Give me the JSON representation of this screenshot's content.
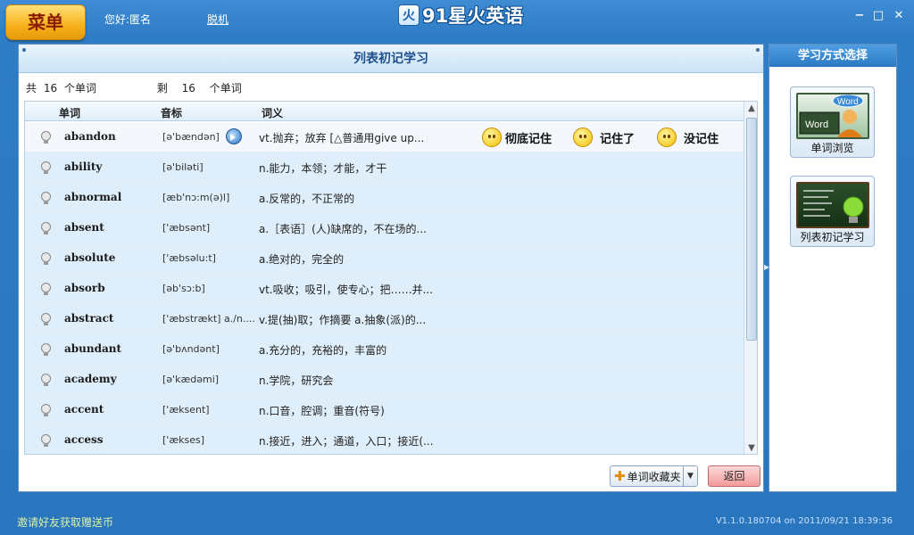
{
  "titlebar": {
    "menu_label": "菜单",
    "greeting": "您好:匿名",
    "offline_link": "脱机",
    "app_title": "91星火英语",
    "logo_glyph": "火",
    "minimize": "−",
    "maximize": "□",
    "close": "✕"
  },
  "panel": {
    "title": "列表初记学习",
    "total_prefix": "共",
    "total_count": "16",
    "total_suffix": "个单词",
    "remain_prefix": "剩",
    "remain_count": "16",
    "remain_suffix": "个单词",
    "columns": [
      "单词",
      "音标",
      "词义"
    ],
    "rows": [
      {
        "word": "abandon",
        "phonetic": "[ə'bændən]",
        "meaning": "vt.抛弃；放弃  [△普通用give up..."
      },
      {
        "word": "ability",
        "phonetic": "[ə'biləti]",
        "meaning": "n.能力，本领；才能，才干"
      },
      {
        "word": "abnormal",
        "phonetic": "[æb'nɔ:m(ə)l]",
        "meaning": "a.反常的，不正常的"
      },
      {
        "word": "absent",
        "phonetic": "['æbsənt]",
        "meaning": "a.［表语］(人)缺席的，不在场的..."
      },
      {
        "word": "absolute",
        "phonetic": "['æbsəlu:t]",
        "meaning": "a.绝对的，完全的"
      },
      {
        "word": "absorb",
        "phonetic": "[əb'sɔ:b]",
        "meaning": "vt.吸收；吸引，使专心；把……并..."
      },
      {
        "word": "abstract",
        "phonetic": "['æbstrækt] a./n....",
        "meaning": "v.提(抽)取；作摘要  a.抽象(派)的..."
      },
      {
        "word": "abundant",
        "phonetic": "[ə'bʌndənt]",
        "meaning": "a.充分的，充裕的，丰富的"
      },
      {
        "word": "academy",
        "phonetic": "[ə'kædəmi]",
        "meaning": "n.学院，研究会"
      },
      {
        "word": "accent",
        "phonetic": "['æksent]",
        "meaning": "n.口音，腔调；重音(符号)"
      },
      {
        "word": "access",
        "phonetic": "['ækses]",
        "meaning": "n.接近，进入；通道，入口；接近(..."
      }
    ],
    "rate_buttons": [
      "彻底记住",
      "记住了",
      "没记住"
    ],
    "favorites_button": "单词收藏夹",
    "back_button": "返回"
  },
  "sidebar": {
    "title": "学习方式选择",
    "modes": [
      {
        "label": "单词浏览",
        "art_words": [
          "Word",
          "Word"
        ]
      },
      {
        "label": "列表初记学习"
      }
    ]
  },
  "statusbar": {
    "invite": "邀请好友获取赠送币",
    "version": "V1.1.0.180704 on 2011/09/21 18:39:36"
  },
  "colors": {
    "window_blue": "#2f7dc6",
    "menu_orange": "#f6b21b",
    "row_blue": "#deeefa",
    "header_text": "#1d4f8c"
  },
  "icons": {
    "bulb": "lightbulb-icon",
    "speaker": "speaker-icon",
    "face": "smiley-face-icon"
  }
}
